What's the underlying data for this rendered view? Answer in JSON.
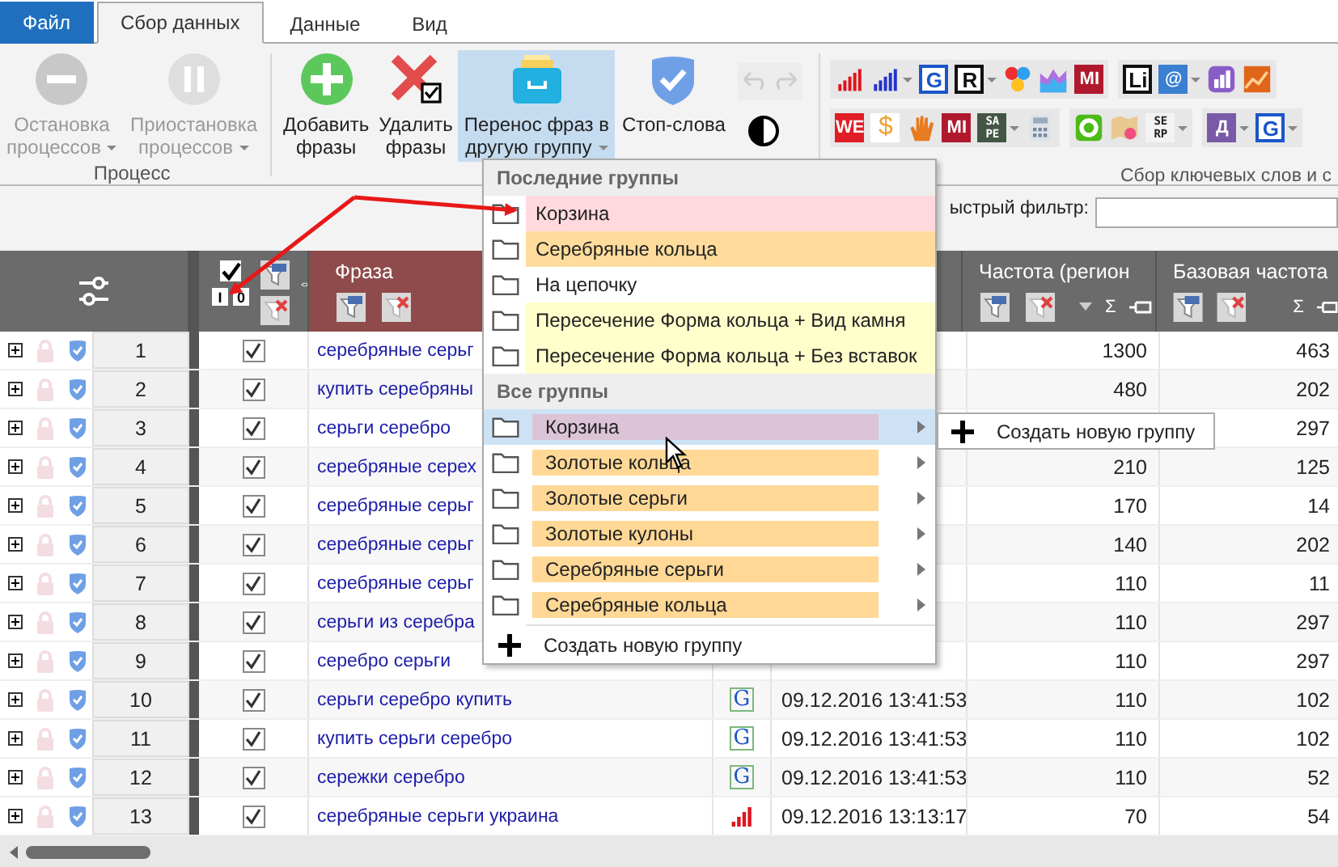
{
  "tabs": [
    {
      "label": "Файл",
      "kind": "file",
      "selected": false
    },
    {
      "label": "Сбор данных",
      "kind": "tab",
      "selected": true
    },
    {
      "label": "Данные",
      "kind": "tab",
      "selected": false
    },
    {
      "label": "Вид",
      "kind": "tab",
      "selected": false
    }
  ],
  "ribbon": {
    "process_buttons": [
      {
        "kind": "stop",
        "label_lines": [
          "Остановка",
          "процессов"
        ],
        "disabled": true,
        "dropdown": true,
        "active": false
      },
      {
        "kind": "pause",
        "label_lines": [
          "Приостановка",
          "процессов"
        ],
        "disabled": true,
        "dropdown": true,
        "active": false
      }
    ],
    "process_group": "Процесс",
    "buttons": [
      {
        "kind": "add",
        "label_lines": [
          "Добавить",
          "фразы"
        ],
        "disabled": false,
        "dropdown": false,
        "active": false
      },
      {
        "kind": "delete",
        "label_lines": [
          "Удалить",
          "фразы"
        ],
        "disabled": false,
        "dropdown": false,
        "active": false
      },
      {
        "kind": "move",
        "label_lines": [
          "Перенос фраз в",
          "другую группу"
        ],
        "disabled": false,
        "dropdown": true,
        "active": true
      },
      {
        "kind": "stopwords",
        "label_lines": [
          "Стоп-слова"
        ],
        "disabled": false,
        "dropdown": false,
        "active": false
      }
    ],
    "tool_rows": [
      [
        [
          {
            "kind": "bars",
            "color": "#e0141e",
            "dropdown": false
          },
          {
            "kind": "bars",
            "color": "#2233cc",
            "dropdown": true
          },
          {
            "kind": "outline",
            "text": "G",
            "color": "#1a56c8",
            "dropdown": false
          },
          {
            "kind": "outline",
            "text": "R",
            "color": "#111111",
            "dropdown": true
          },
          {
            "kind": "dots",
            "dropdown": false
          },
          {
            "kind": "area",
            "dropdown": false
          },
          {
            "kind": "solid",
            "text": "MI",
            "color": "#b0192d",
            "dropdown": false
          }
        ],
        [
          {
            "kind": "outline",
            "text": "Li",
            "color": "#111111",
            "dropdown": false
          },
          {
            "kind": "solid",
            "text": "@",
            "color": "#3a7fd0",
            "dropdown": true
          },
          {
            "kind": "barstile",
            "color": "#8a5cc8",
            "dropdown": false
          },
          {
            "kind": "linetile",
            "color": "#e0641a",
            "dropdown": false
          }
        ]
      ],
      [
        [
          {
            "kind": "solid",
            "text": "WE",
            "color": "#e01c24",
            "dropdown": false
          },
          {
            "kind": "plain",
            "text": "$",
            "color": "#f0a030",
            "dropdown": false
          },
          {
            "kind": "hand",
            "color": "#e87a20",
            "dropdown": false
          },
          {
            "kind": "solid",
            "text": "MI",
            "color": "#b0192d",
            "dropdown": false
          },
          {
            "kind": "quad",
            "text": "SAPE",
            "color": "#445544",
            "dropdown": true
          },
          {
            "kind": "calc",
            "dropdown": false
          }
        ],
        [
          {
            "kind": "ring",
            "color": "#4cbb17",
            "dropdown": false
          },
          {
            "kind": "map",
            "dropdown": false
          },
          {
            "kind": "quadlight",
            "text": "SERP",
            "color": "#222222",
            "dropdown": true
          }
        ],
        [
          {
            "kind": "solid",
            "text": "Д",
            "color": "#7a5aa8",
            "dropdown": true
          },
          {
            "kind": "outline",
            "text": "G",
            "color": "#1a56c8",
            "dropdown": true
          }
        ]
      ]
    ],
    "tools_group": "Сбор ключевых слов и с"
  },
  "filter": {
    "label": "ыстрый фильтр:"
  },
  "table": {
    "check_header": {
      "checked": true,
      "toggles": [
        "I",
        "0"
      ]
    },
    "phrase_title": "Фраза",
    "columns": [
      {
        "title": "Частота (регион",
        "sum": "Σ",
        "sorted": true
      },
      {
        "title": "Базовая частота",
        "sum": "Σ",
        "sorted": false
      }
    ],
    "rows": [
      {
        "number": "1",
        "checked": true,
        "phrase": "серебряные серьг",
        "freq": "1300",
        "base": "463"
      },
      {
        "number": "2",
        "checked": true,
        "phrase": "купить серебряны",
        "freq": "480",
        "base": "202"
      },
      {
        "number": "3",
        "checked": true,
        "phrase": "серьги серебро",
        "base": "297"
      },
      {
        "number": "4",
        "checked": true,
        "phrase": "серебряные серех",
        "freq": "210",
        "base": "125"
      },
      {
        "number": "5",
        "checked": true,
        "phrase": "серебряные серьг",
        "freq": "170",
        "base": "14"
      },
      {
        "number": "6",
        "checked": true,
        "phrase": "серебряные серьг",
        "freq": "140",
        "base": "202"
      },
      {
        "number": "7",
        "checked": true,
        "phrase": "серебряные серьг",
        "freq": "110",
        "base": "11"
      },
      {
        "number": "8",
        "checked": true,
        "phrase": "серьги из серебра",
        "freq": "110",
        "base": "297"
      },
      {
        "number": "9",
        "checked": true,
        "phrase": "серебро серьги",
        "freq": "110",
        "base": "297"
      },
      {
        "number": "10",
        "checked": true,
        "phrase": "серьги серебро купить",
        "source": {
          "kind": "letter",
          "text": "G"
        },
        "date": "09.12.2016 13:41:53",
        "freq": "110",
        "base": "102"
      },
      {
        "number": "11",
        "checked": true,
        "phrase": "купить серьги серебро",
        "source": {
          "kind": "letter",
          "text": "G"
        },
        "date": "09.12.2016 13:41:53",
        "freq": "110",
        "base": "102"
      },
      {
        "number": "12",
        "checked": true,
        "phrase": "сережки серебро",
        "source": {
          "kind": "letter",
          "text": "G"
        },
        "date": "09.12.2016 13:41:53",
        "freq": "110",
        "base": "52"
      },
      {
        "number": "13",
        "checked": true,
        "phrase": "серебряные серьги украина",
        "source": {
          "kind": "bars"
        },
        "date": "09.12.2016 13:13:17",
        "freq": "70",
        "base": "54"
      }
    ]
  },
  "menu": {
    "recent_title": "Последние группы",
    "recent": [
      {
        "label": "Корзина",
        "color": "#ffd9de"
      },
      {
        "label": "Серебряные кольца",
        "color": "#ffdc9c"
      },
      {
        "label": "На цепочку",
        "color": "#ffffff"
      },
      {
        "label": "Пересечение Форма кольца + Вид камня",
        "color": "#ffffcc"
      },
      {
        "label": "Пересечение Форма кольца + Без вставок",
        "color": "#ffffcc"
      }
    ],
    "all_title": "Все группы",
    "all": [
      {
        "label": "Корзина",
        "color": "#dcc4d6",
        "selected": true
      },
      {
        "label": "Золотые кольца",
        "color": "#ffd896",
        "selected": false
      },
      {
        "label": "Золотые серьги",
        "color": "#ffd896",
        "selected": false
      },
      {
        "label": "Золотые кулоны",
        "color": "#ffd896",
        "selected": false
      },
      {
        "label": "Серебряные серьги",
        "color": "#ffd896",
        "selected": false
      },
      {
        "label": "Серебряные кольца",
        "color": "#ffd896",
        "selected": false
      }
    ],
    "create": "Создать новую группу",
    "submenu": {
      "create": "Создать новую группу"
    }
  }
}
